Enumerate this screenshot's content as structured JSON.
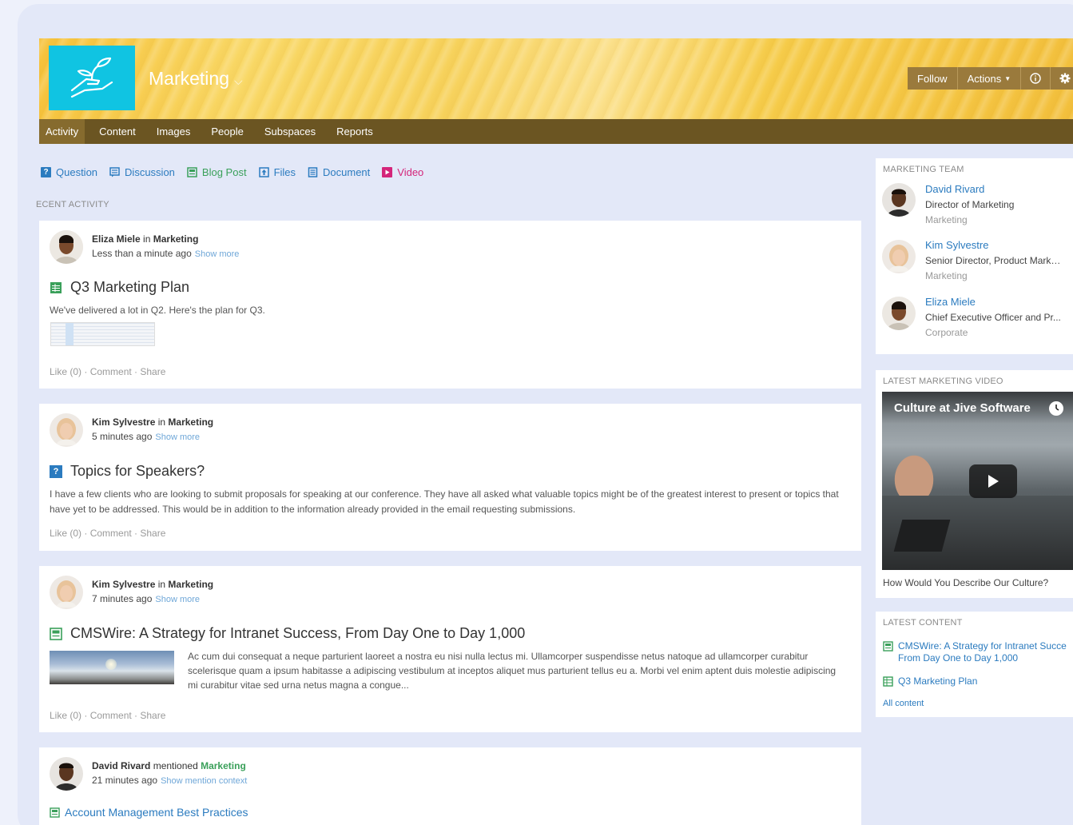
{
  "space": {
    "title": "Marketing",
    "buttons": {
      "follow": "Follow",
      "actions": "Actions"
    }
  },
  "tabs": [
    "Activity",
    "Content",
    "Images",
    "People",
    "Subspaces",
    "Reports"
  ],
  "create": [
    {
      "label": "Question",
      "color": "#2b7bbf",
      "icon": "question-icon"
    },
    {
      "label": "Discussion",
      "color": "#2b7bbf",
      "icon": "discussion-icon"
    },
    {
      "label": "Blog Post",
      "color": "#3aa05a",
      "icon": "blog-icon"
    },
    {
      "label": "Files",
      "color": "#2b7bbf",
      "icon": "file-upload-icon"
    },
    {
      "label": "Document",
      "color": "#2b7bbf",
      "icon": "document-icon"
    },
    {
      "label": "Video",
      "color": "#d4257a",
      "icon": "video-icon"
    }
  ],
  "recent_label": "ECENT ACTIVITY",
  "posts": [
    {
      "author": "Eliza Miele",
      "in": "in",
      "place": "Marketing",
      "time": "Less than a minute ago",
      "more": "Show more",
      "title": "Q3 Marketing Plan",
      "body": "We've delivered a lot in Q2.  Here's the plan for Q3.",
      "like": "Like (0)",
      "comment": "Comment",
      "share": "Share"
    },
    {
      "author": "Kim Sylvestre",
      "in": "in",
      "place": "Marketing",
      "time": "5 minutes ago",
      "more": "Show more",
      "title": "Topics for Speakers?",
      "body": "I have a few clients who are looking to submit proposals for speaking at our conference. They have all asked what valuable topics might be of the greatest interest to present or topics that have yet to be addressed. This would be in addition to the information already provided in the email requesting submissions.",
      "like": "Like (0)",
      "comment": "Comment",
      "share": "Share"
    },
    {
      "author": "Kim Sylvestre",
      "in": "in",
      "place": "Marketing",
      "time": "7 minutes ago",
      "more": "Show more",
      "title": "CMSWire: A Strategy for Intranet Success, From Day One to Day 1,000",
      "body": "Ac cum dui consequat a neque parturient laoreet a nostra eu nisi nulla lectus mi. Ullamcorper suspendisse netus natoque ad ullamcorper curabitur scelerisque quam a ipsum habitasse a adipiscing vestibulum at inceptos aliquet mus parturient tellus eu a. Morbi vel enim aptent duis molestie adipiscing mi curabitur vitae sed urna netus magna a congue...",
      "like": "Like (0)",
      "comment": "Comment",
      "share": "Share"
    },
    {
      "author": "David Rivard",
      "in": "mentioned",
      "place": "Marketing",
      "time": "21 minutes ago",
      "more": "Show mention context",
      "title": "Account Management Best Practices"
    }
  ],
  "sidebar": {
    "team_heading": "MARKETING TEAM",
    "team": [
      {
        "name": "David Rivard",
        "role": "Director of Marketing",
        "dept": "Marketing"
      },
      {
        "name": "Kim Sylvestre",
        "role": "Senior Director, Product Marke...",
        "dept": "Marketing"
      },
      {
        "name": "Eliza Miele",
        "role": "Chief Executive Officer and Pr...",
        "dept": "Corporate"
      }
    ],
    "video_heading": "LATEST MARKETING VIDEO",
    "video_title": "Culture at Jive Software",
    "video_caption": "How Would You Describe Our Culture?",
    "content_heading": "LATEST CONTENT",
    "content": [
      {
        "line1": "CMSWire: A Strategy for Intranet Succe",
        "line2": "From Day One to Day 1,000"
      },
      {
        "line1": "Q3 Marketing Plan"
      }
    ],
    "all_content": "All content"
  }
}
